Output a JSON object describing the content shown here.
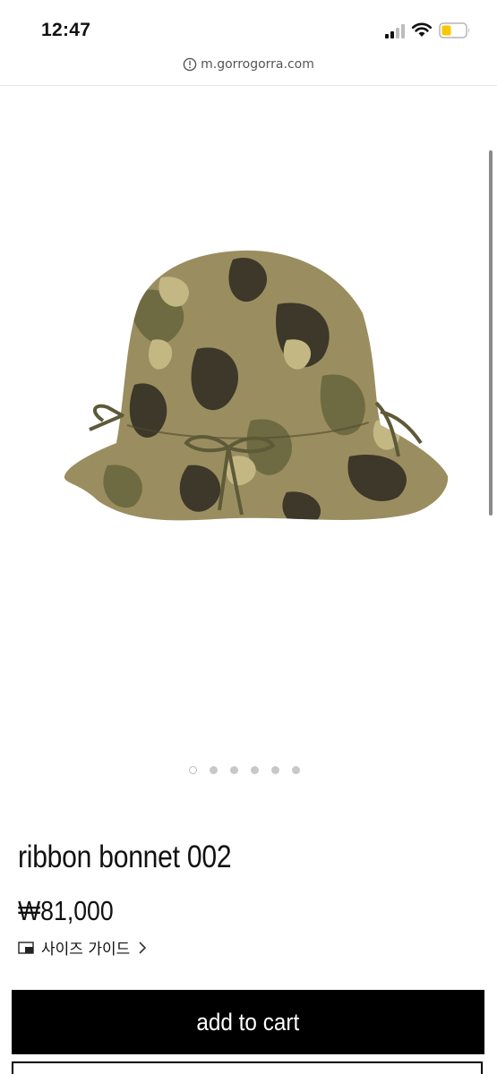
{
  "status_bar": {
    "time": "12:47",
    "icons": [
      "signal-icon",
      "wifi-icon",
      "battery-icon"
    ],
    "battery_color": "#f7c800"
  },
  "browser": {
    "url": "m.gorrogorra.com",
    "url_icon": "info-icon"
  },
  "product": {
    "image": "camo-bucket-hat-image",
    "carousel": {
      "total": 6,
      "current": 1
    },
    "name": "ribbon bonnet 002",
    "price": "₩81,000",
    "size_guide_label": "사이즈 가이드",
    "size_guide_icon": "size-guide-icon"
  },
  "actions": {
    "add_to_cart_label": "add to cart"
  },
  "colors": {
    "button_bg": "#000000",
    "button_text": "#ffffff",
    "camo_light": "#a69a6c",
    "camo_mid": "#6e6b42",
    "camo_dark": "#3d3829"
  }
}
